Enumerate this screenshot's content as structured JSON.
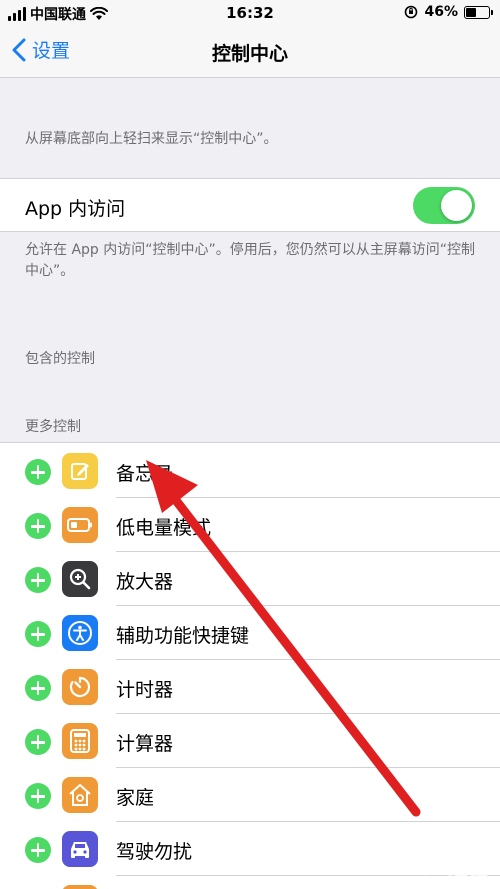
{
  "status": {
    "carrier": "中国联通",
    "time": "16:32",
    "battery": "46%",
    "battery_level": 0.46
  },
  "nav": {
    "back_label": "设置",
    "title": "控制中心"
  },
  "swipe_description": "从屏幕底部向上轻扫来显示“控制中心”。",
  "app_access": {
    "label": "App 内访问",
    "enabled": true,
    "description": "允许在 App 内访问“控制中心”。停用后，您仍然可以从主屏幕访问“控制中心”。"
  },
  "included_header": "包含的控制",
  "more_header": "更多控制",
  "more_controls": [
    {
      "label": "备忘录",
      "icon": "notes-icon",
      "color": "#f7cd46"
    },
    {
      "label": "低电量模式",
      "icon": "battery-icon",
      "color": "#f09a37"
    },
    {
      "label": "放大器",
      "icon": "magnifier-icon",
      "color": "#3a3a3c"
    },
    {
      "label": "辅助功能快捷键",
      "icon": "accessibility-icon",
      "color": "#1a7cf5"
    },
    {
      "label": "计时器",
      "icon": "timer-icon",
      "color": "#f09a37"
    },
    {
      "label": "计算器",
      "icon": "calculator-icon",
      "color": "#f09a37"
    },
    {
      "label": "家庭",
      "icon": "home-icon",
      "color": "#f09a37"
    },
    {
      "label": "驾驶勿扰",
      "icon": "car-icon",
      "color": "#5856d6"
    },
    {
      "label": "",
      "icon": "partial-icon",
      "color": "#f09a37"
    }
  ],
  "watermark": "Bai 经验",
  "colors": {
    "accent": "#1a7cf5",
    "toggle_on": "#4cd964",
    "annotation_arrow": "#e02020"
  }
}
